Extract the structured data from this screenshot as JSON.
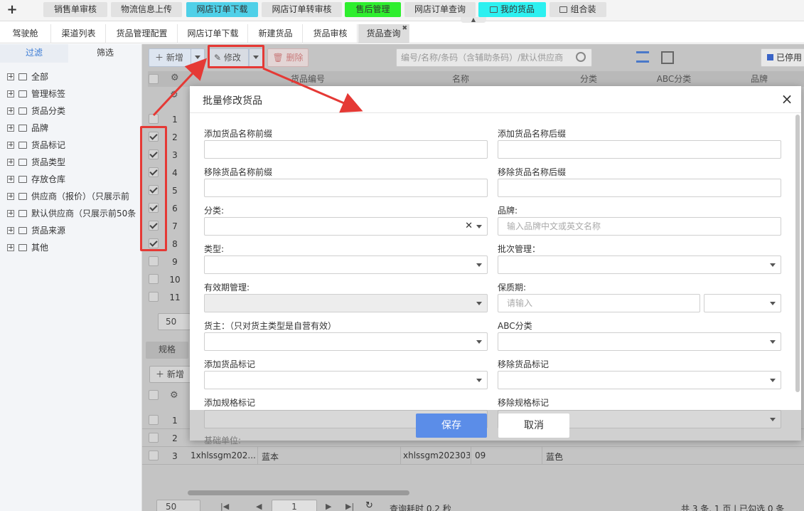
{
  "top_nav": {
    "tabs": [
      {
        "label": "销售单审核",
        "bg": "#e2e2e2"
      },
      {
        "label": "物流信息上传",
        "bg": "#e2e2e2"
      },
      {
        "label": "网店订单下载",
        "bg": "#4fd0e8"
      },
      {
        "label": "网店订单转审核",
        "bg": "#e2e2e2"
      },
      {
        "label": "售后管理",
        "bg": "#2eee2e"
      },
      {
        "label": "网店订单查询",
        "bg": "#e2e2e2"
      },
      {
        "label": "我的货品",
        "bg": "#2cf0f0"
      },
      {
        "label": "组合装",
        "bg": "#e2e2e2"
      }
    ]
  },
  "sub_tabs": {
    "items": [
      "驾驶舱",
      "渠道列表",
      "货品管理配置",
      "网店订单下载",
      "新建货品",
      "货品审核",
      "货品查询"
    ],
    "active_index": 6
  },
  "left_panel": {
    "tab_filter": "过滤",
    "tab_screen": "筛选",
    "tree": [
      "全部",
      "管理标签",
      "货品分类",
      "品牌",
      "货品标记",
      "货品类型",
      "存放仓库",
      "供应商（报价）（只展示前",
      "默认供应商（只展示前50条",
      "货品来源",
      "其他"
    ]
  },
  "toolbar": {
    "add_label": "新增",
    "edit_label": "修改",
    "delete_label": "删除",
    "search_placeholder": "编号/名称/条码（含辅助条码）/默认供应商",
    "disabled_toggle_label": "已停用"
  },
  "main_grid": {
    "headers": [
      "货品编号",
      "名称",
      "分类",
      "ABC分类",
      "品牌"
    ],
    "row_numbers": [
      "1",
      "2",
      "3",
      "4",
      "5",
      "6",
      "7",
      "8",
      "9",
      "10",
      "11"
    ],
    "checked": [
      false,
      true,
      true,
      true,
      true,
      true,
      true,
      true,
      false,
      false,
      false
    ],
    "page_size": "50"
  },
  "spec_grid": {
    "tab_label": "规格",
    "add_label": "新增",
    "row_numbers": [
      "1",
      "2",
      "3"
    ],
    "rows": [
      {
        "code": "",
        "name": "",
        "spec_code": "",
        "spec": "",
        "color": ""
      },
      {
        "code": "",
        "name": "",
        "spec_code": "",
        "spec": "",
        "color": ""
      },
      {
        "code": "1xhlssgm202...",
        "name": "蓝本",
        "spec_code": "xhlssgm202303",
        "spec": "09",
        "color": "蓝色"
      }
    ]
  },
  "pager": {
    "page_size": "50",
    "page": "1",
    "elapsed": "查询耗时 0.2 秒",
    "summary": "共 3 条, 1 页 | 已勾选 0 条"
  },
  "modal": {
    "title": "批量修改货品",
    "close": "×",
    "fields": {
      "add_name_prefix": "添加货品名称前缀",
      "add_name_suffix": "添加货品名称后缀",
      "remove_name_prefix": "移除货品名称前缀",
      "remove_name_suffix": "移除货品名称后缀",
      "category": "分类:",
      "brand": "品牌:",
      "brand_placeholder": "输入品牌中文或英文名称",
      "type": "类型:",
      "batch_mgmt": "批次管理：",
      "expiry_mgmt": "有效期管理:",
      "shelf_life": "保质期:",
      "shelf_life_placeholder": "请输入",
      "owner": "货主：（只对货主类型是自营有效）",
      "abc": "ABC分类",
      "add_goods_mark": "添加货品标记",
      "remove_goods_mark": "移除货品标记",
      "add_spec_mark": "添加规格标记",
      "remove_spec_mark": "移除规格标记",
      "base_unit": "基础单位:"
    },
    "save": "保存",
    "cancel": "取消"
  },
  "colors": {
    "annotation_red": "#e53935",
    "primary_blue": "#5b8de8"
  }
}
